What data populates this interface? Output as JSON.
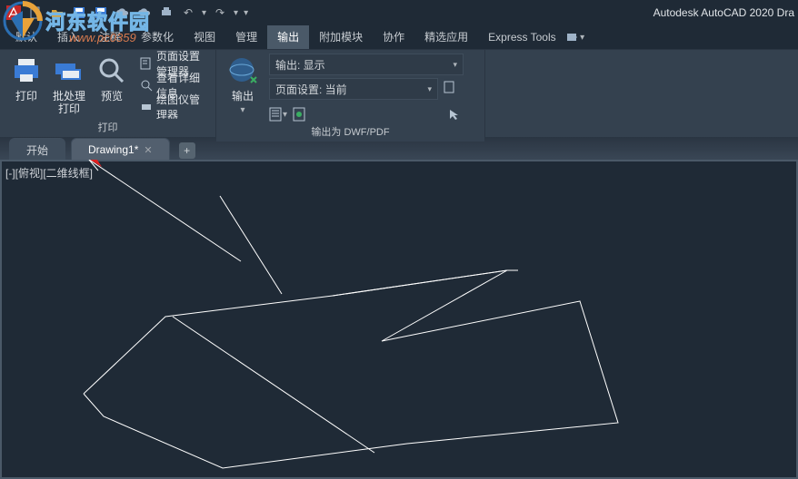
{
  "title": "Autodesk AutoCAD 2020   Dra",
  "menu": {
    "default": "默认",
    "insert": "插入",
    "annotate": "注释",
    "parametric": "参数化",
    "view": "视图",
    "manage": "管理",
    "output": "输出",
    "addins": "附加模块",
    "collaborate": "协作",
    "featured": "精选应用",
    "express": "Express Tools"
  },
  "print_panel": {
    "plot": "打印",
    "batch": "批处理\n打印",
    "preview": "预览",
    "page_setup": "页面设置管理器",
    "details": "查看详细信息",
    "plotter": "绘图仪管理器",
    "title": "打印"
  },
  "export_panel": {
    "big": "输出",
    "dd1": "输出: 显示",
    "dd2": "页面设置: 当前",
    "title": "输出为 DWF/PDF"
  },
  "tabs": {
    "start": "开始",
    "drawing": "Drawing1*"
  },
  "viewport_label": "[-][俯视][二维线框]",
  "watermark": {
    "text": "河东软件园",
    "sub": "www.pc0359"
  }
}
